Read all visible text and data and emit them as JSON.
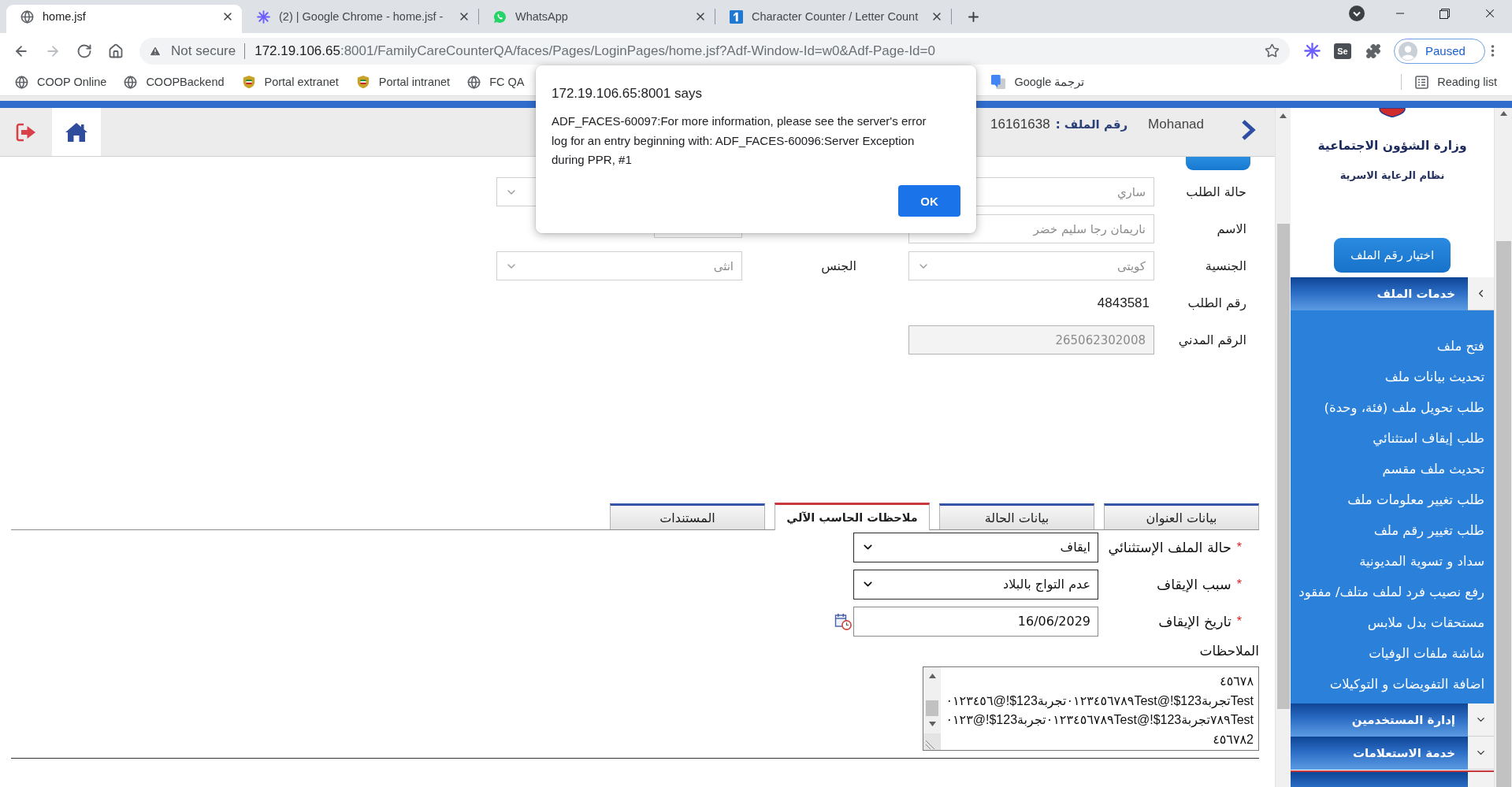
{
  "browser": {
    "tabs": [
      {
        "title": "Character Counter / Letter Count",
        "kind": "counter",
        "selected": false
      },
      {
        "title": "WhatsApp",
        "kind": "whatsapp",
        "selected": false
      },
      {
        "title": "(2) | Google Chrome - home.jsf -",
        "kind": "sparkle",
        "selected": false
      },
      {
        "title": "home.jsf",
        "kind": "globe",
        "selected": true
      }
    ],
    "nav": [
      {
        "kind": "back",
        "disabled": false
      },
      {
        "kind": "forward",
        "disabled": true
      },
      {
        "kind": "reload",
        "disabled": false
      },
      {
        "kind": "home",
        "disabled": false
      }
    ],
    "security": "Not secure",
    "url_host": "172.19.106.65",
    "url_path": ":8001/FamilyCareCounterQA/faces/Pages/LoginPages/home.jsf?Adf-Window-Id=w0&Adf-Page-Id=0",
    "extensions": [
      {
        "kind": "sparkle"
      },
      {
        "kind": "tile",
        "label": "Se"
      },
      {
        "kind": "puzzle"
      }
    ],
    "profile": "Paused",
    "reading_list": "Reading list",
    "bookmarks": [
      {
        "label": "Google ترجمة",
        "kind": "translate"
      },
      {
        "label": "FC QA",
        "kind": "globe"
      },
      {
        "label": "Portal intranet",
        "kind": "emblem"
      },
      {
        "label": "Portal extranet",
        "kind": "emblem"
      },
      {
        "label": "COOPBackend",
        "kind": "globe"
      },
      {
        "label": "COOP Online",
        "kind": "globe"
      }
    ]
  },
  "dialog": {
    "title": "172.19.106.65:8001 says",
    "message": "ADF_FACES-60097:For more information, please see the server's error log for an entry beginning with: ADF_FACES-60096:Server Exception during PPR, #1",
    "button": "OK"
  },
  "header": {
    "file_number": "16161638",
    "file_label": "رقم الملف :",
    "user": "Mohanad"
  },
  "request_form": {
    "rows": [
      [
        {
          "label": "حالة الطلب",
          "kind": "text",
          "value": "ساري",
          "disabled": true
        },
        {
          "kind": "select",
          "disabled": true
        }
      ],
      [
        {
          "label": "الاسم",
          "kind": "text",
          "value": "ناريمان رجا سليم خضر",
          "disabled": true
        },
        {
          "kind": "short"
        }
      ],
      [
        {
          "label": "الجنسية",
          "kind": "select",
          "value": "كويتى",
          "disabled": true
        },
        {
          "label": "الجنس",
          "kind": "select",
          "value": "انثى",
          "disabled": true
        }
      ],
      [
        {
          "label": "رقم الطلب",
          "kind": "static",
          "value": "4843581"
        }
      ],
      [
        {
          "label": "الرقم المدني",
          "kind": "readonly",
          "value": "265062302008",
          "disabled": true
        }
      ]
    ]
  },
  "tabs": [
    {
      "label": "بيانات العنوان",
      "selected": false
    },
    {
      "label": "بيانات الحالة",
      "selected": false
    },
    {
      "label": "ملاحظات الحاسب الآلي",
      "selected": true
    },
    {
      "label": "المستندات",
      "selected": false
    }
  ],
  "exception_form": {
    "fields": [
      {
        "label": "حالة الملف الإستثنائي",
        "required_mark": "*",
        "kind": "select",
        "value": "ايقاف"
      },
      {
        "label": "سبب الإيقاف",
        "required_mark": "*",
        "kind": "select",
        "value": "عدم التواج بالبلاد"
      },
      {
        "label": "تاريخ الإيقاف",
        "required_mark": "*",
        "kind": "date",
        "value": "16/06/2029"
      }
    ],
    "notes": {
      "label": "الملاحظات",
      "lines": [
        "٤٥٦٧٨",
        "٠١٢٣٤٥٦@!$123٠١٢٣٤٥٦٧٨٩تجربةTest@!$123تجربةTest",
        "٠١٢٣@!$123٠١٢٣٤٥٦٧٨٩تجربةTest@!$123٧٨٩تجربةTest",
        "٤٥٦٧٨2"
      ]
    }
  },
  "sidebar": {
    "ministry": "وزارة الشؤون الاجتماعية",
    "system": "نظام الرعاية الاسرية",
    "select_button": "اختيار رقم الملف",
    "sections": [
      {
        "title": "خدمات الملف",
        "expanded": true,
        "items": [
          "فتح ملف",
          "تحديث بيانات ملف",
          "طلب تحويل ملف (فئة، وحدة)",
          "طلب إيقاف استثنائي",
          "تحديث ملف مقسم",
          "طلب تغيير معلومات ملف",
          "طلب تغيير رقم ملف",
          "سداد و تسوية المديونية",
          "رفع نصيب فرد لملف متلف/ مفقود",
          "مستحقات بدل ملابس",
          "شاشة ملفات الوفيات",
          "اضافة التفويضات و التوكيلات"
        ]
      },
      {
        "title": "إدارة المستخدمين",
        "expanded": false
      },
      {
        "title": "خدمة الاستعلامات",
        "expanded": false
      }
    ]
  }
}
